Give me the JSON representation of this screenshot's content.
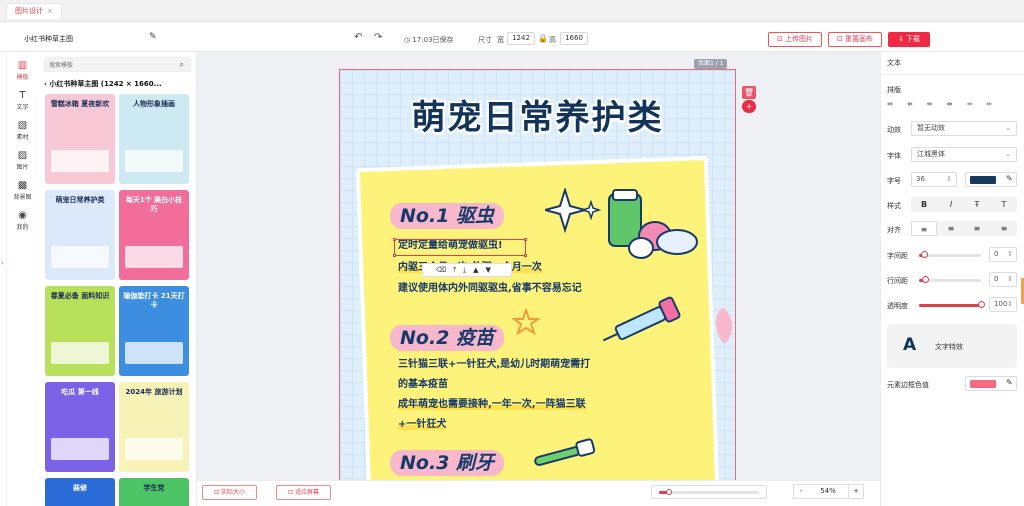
{
  "tab": {
    "title": "图片设计",
    "close": "×"
  },
  "toolbar": {
    "doc_title": "小红书种草主图",
    "saved": "17:03已保存",
    "size_label": "尺寸",
    "width_label": "宽",
    "width_value": "1242",
    "height_label": "高",
    "height_value": "1660",
    "upload_label": "上传图片",
    "reset_label": "重置画布",
    "download_label": "下载"
  },
  "iconbar": [
    {
      "label": "模板",
      "icon": "template-icon",
      "glyph": "▥"
    },
    {
      "label": "文字",
      "icon": "text-icon",
      "glyph": "T"
    },
    {
      "label": "素材",
      "icon": "material-icon",
      "glyph": "▧"
    },
    {
      "label": "图片",
      "icon": "image-icon",
      "glyph": "▨"
    },
    {
      "label": "背景图",
      "icon": "background-icon",
      "glyph": "▩"
    },
    {
      "label": "我的",
      "icon": "user-icon",
      "glyph": "◉"
    }
  ],
  "panel": {
    "search_placeholder": "搜索模板",
    "breadcrumb": "小红书种草主图 (1242 × 1660...",
    "back": "‹",
    "thumbs": [
      {
        "title": "雪糕冰箱 夏夜新欢",
        "bg": "#f7c9d6"
      },
      {
        "title": "人物形象插画",
        "bg": "#cdeaf3"
      },
      {
        "title": "萌宠日常养护类",
        "bg": "#dbe9fa"
      },
      {
        "title": "每天1个 美白小技巧",
        "bg": "#f36d9a"
      },
      {
        "title": "春夏必备 面料知识",
        "bg": "#b8e05a"
      },
      {
        "title": "瑜伽垫打卡 21天打卡",
        "bg": "#3d8de0"
      },
      {
        "title": "吃瓜 第一线",
        "bg": "#7b61e6"
      },
      {
        "title": "2024年 旅游计划",
        "bg": "#f7f2b5"
      },
      {
        "title": "装修",
        "bg": "#2a6bd8"
      },
      {
        "title": "学生党",
        "bg": "#4cc465"
      }
    ]
  },
  "canvas": {
    "page_indicator": "页面1 / 1",
    "headline": "萌宠日常养护类",
    "sections": [
      {
        "title": "No.1 驱虫",
        "lines": [
          "定时定量给萌宠做驱虫!",
          "内驱三个月一次,外驱一个月一次",
          "建议使用体内外同驱驱虫,省事不容易忘记"
        ]
      },
      {
        "title": "No.2 疫苗",
        "lines": [
          "三针猫三联+一针狂犬,是幼儿时期萌宠需打",
          "的基本疫苗",
          "成年萌宠也需要接种,一年一次,一阵猫三联",
          "+一针狂犬"
        ]
      },
      {
        "title": "No.3 刷牙",
        "lines": []
      }
    ],
    "mini_toolbar": "⌫⤒⤓▲▼",
    "delete": "🗑",
    "add": "+"
  },
  "bottom": {
    "actual_size": "实际大小",
    "fit_screen": "适应屏幕",
    "zoom_fraction": 0.1,
    "zoom_minus": "-",
    "zoom_value": "54%",
    "zoom_plus": "+"
  },
  "right_panel": {
    "header": "文本",
    "arrange_label": "排版",
    "arrange_icons": "⇹⇻⇺⇼⇸⇷",
    "animation_label": "动效",
    "animation_value": "暂无动效",
    "font_label": "字体",
    "font_value": "江城黑体",
    "fontsize_label": "字号",
    "fontsize_value": "36",
    "text_color": "#173a5e",
    "style_label": "样式",
    "styles": [
      "B",
      "I",
      "Ŧ",
      "T"
    ],
    "align_label": "对齐",
    "aligns": [
      "≡",
      "≡",
      "≡",
      "≡"
    ],
    "letter_spacing_label": "字间距",
    "letter_spacing_value": "0",
    "letter_spacing_fraction": 0.08,
    "line_spacing_label": "行间距",
    "line_spacing_value": "0",
    "line_spacing_fraction": 0.1,
    "opacity_label": "透明度",
    "opacity_value": "100",
    "opacity_fraction": 1,
    "effect_glyph": "A",
    "effect_label": "文字特效",
    "border_label": "元素边框色值",
    "border_color": "#f56a80"
  }
}
